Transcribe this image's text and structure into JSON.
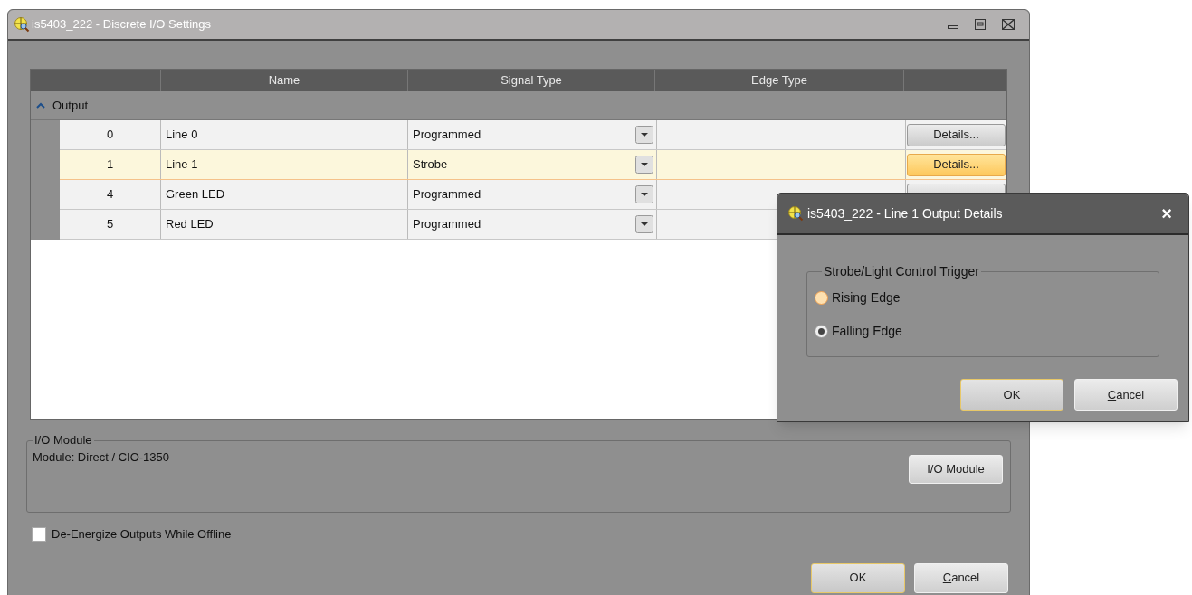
{
  "window": {
    "title": "is5403_222 - Discrete I/O Settings"
  },
  "table": {
    "columns": [
      "Name",
      "Signal Type",
      "Edge Type"
    ],
    "group": {
      "label": "Output",
      "expanded": true
    },
    "rows": [
      {
        "index": "0",
        "name": "Line 0",
        "signal_type": "Programmed",
        "selected": false,
        "has_button": true,
        "details": "Details..."
      },
      {
        "index": "1",
        "name": "Line 1",
        "signal_type": "Strobe",
        "selected": true,
        "has_button": true,
        "details": "Details..."
      },
      {
        "index": "4",
        "name": "Green LED",
        "signal_type": "Programmed",
        "selected": false,
        "has_button": true
      },
      {
        "index": "5",
        "name": "Red LED",
        "signal_type": "Programmed",
        "selected": false,
        "has_button": false
      }
    ]
  },
  "io_module": {
    "legend": "I/O Module",
    "text": "Module: Direct / CIO-1350",
    "button": "I/O Module"
  },
  "deenergize": {
    "label": "De-Energize Outputs While Offline",
    "checked": false
  },
  "buttons": {
    "ok": "OK",
    "cancel": "Cancel"
  },
  "dialog": {
    "title": "is5403_222 - Line 1 Output Details",
    "close": "×",
    "legend": "Strobe/Light Control Trigger",
    "options": [
      {
        "label": "Rising Edge",
        "selected": false,
        "hover": true
      },
      {
        "label": "Falling Edge",
        "selected": true,
        "hover": false
      }
    ],
    "ok": "OK",
    "cancel": "Cancel"
  }
}
